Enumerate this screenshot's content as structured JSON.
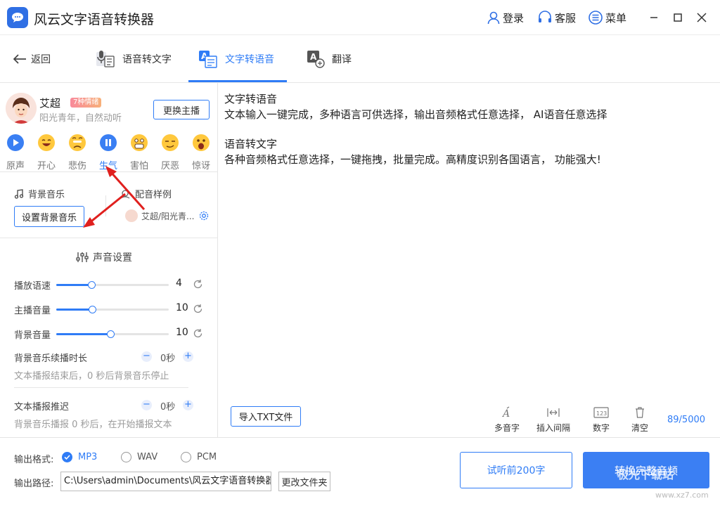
{
  "app": {
    "title": "风云文字语音转换器"
  },
  "header": {
    "login": "登录",
    "service": "客服",
    "menu": "菜单"
  },
  "tabs": {
    "back": "返回",
    "items": [
      "语音转文字",
      "文字转语音",
      "翻译"
    ],
    "active": "文字转语音"
  },
  "anchor": {
    "name": "艾超",
    "emotion_badge": "7种情绪",
    "desc": "阳光青年，自然动听",
    "switch_label": "更换主播"
  },
  "emotions": [
    {
      "label": "原声"
    },
    {
      "label": "开心"
    },
    {
      "label": "悲伤"
    },
    {
      "label": "生气"
    },
    {
      "label": "害怕"
    },
    {
      "label": "厌恶"
    },
    {
      "label": "惊讶"
    }
  ],
  "active_emotion": "生气",
  "bgm": {
    "label": "背景音乐",
    "button": "设置背景音乐"
  },
  "sample": {
    "label": "配音样例",
    "voice": "艾超/阳光青..."
  },
  "voice_settings": {
    "title": "声音设置",
    "sliders": [
      {
        "label": "播放语速",
        "value": "4",
        "level": 0.31
      },
      {
        "label": "主播音量",
        "value": "10",
        "level": 0.32
      },
      {
        "label": "背景音量",
        "value": "10",
        "level": 0.48
      }
    ],
    "bgm_duration": {
      "label": "背景音乐续播时长",
      "value": "0秒",
      "note": "文本播报结束后，0 秒后背景音乐停止"
    },
    "delay": {
      "label": "文本播报推迟",
      "value": "0秒",
      "note": "背景音乐播报 0 秒后，在开始播报文本"
    }
  },
  "editor": {
    "lines": [
      "文字转语音",
      "文本输入一键完成，多种语言可供选择，输出音频格式任意选择， AI语音任意选择",
      "",
      "语音转文字",
      "各种音频格式任意选择，一键拖拽，批量完成。高精度识别各国语言， 功能强大!"
    ],
    "import_button": "导入TXT文件",
    "tools": [
      "多音字",
      "插入间隔",
      "数字",
      "清空"
    ],
    "counter": "89/5000"
  },
  "output": {
    "format_label": "输出格式:",
    "formats": [
      "MP3",
      "WAV",
      "PCM"
    ],
    "selected_format": "MP3",
    "path_label": "输出路径:",
    "path": "C:\\Users\\admin\\Documents\\风云文字语音转换器",
    "change_dir": "更改文件夹",
    "preview": "试听前200字",
    "convert": "转换完整音频"
  },
  "watermark": {
    "brand": "极光下载站",
    "url": "www.xz7.com"
  },
  "colors": {
    "accent": "#2f7cf6",
    "annotation_arrow": "#e0201e"
  },
  "icons": {
    "tools": [
      "polyphone-icon",
      "interval-icon",
      "number-icon",
      "trash-icon"
    ]
  }
}
